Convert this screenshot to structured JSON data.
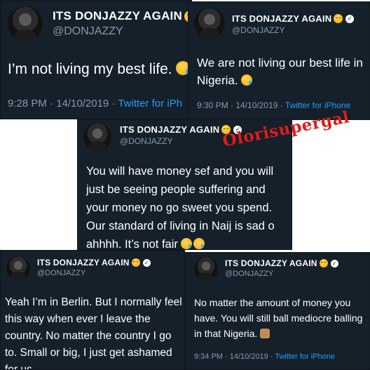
{
  "tweets": [
    {
      "display_name": "ITS DONJAZZY AGAIN",
      "handle": "@DONJAZZY",
      "text": "I’m not living my best life.",
      "time": "9:28 PM · 14/10/2019 ·",
      "source": "Twitter for iPh"
    },
    {
      "display_name": "ITS DONJAZZY AGAIN",
      "handle": "@DONJAZZY",
      "text": "We are not living our best life in Nigeria.",
      "time": "9:30 PM · 14/10/2019 ·",
      "source": "Twitter for iPhone"
    },
    {
      "display_name": "ITS DONJAZZY AGAIN",
      "handle": "@DONJAZZY",
      "text": "You will have money sef and you will just be seeing people suffering and your money no go sweet you spend. Our standard of living in Naij is sad o ahhhh. It’s not fair"
    },
    {
      "display_name": "ITS DONJAZZY AGAIN",
      "handle": "@DONJAZZY",
      "text": "Yeah I’m in Berlin. But I normally feel this way when ever I leave the country. No matter the country I go to. Small or big, I just get ashamed for us."
    },
    {
      "display_name": "ITS DONJAZZY AGAIN",
      "handle": "@DONJAZZY",
      "text": "No matter the amount of money you have. You will still ball mediocre balling in that Nigeria.",
      "time": "9:34 PM · 14/10/2019 ·",
      "source": "Twitter for iPhone"
    }
  ],
  "watermark": "Olorisupergal",
  "icons": {
    "verified": "verified-badge-icon",
    "emoji_smirk": "smirk-emoji-icon",
    "emoji_cry": "crying-face-emoji-icon",
    "emoji_person": "man-facepalming-emoji-icon",
    "chevron": "chevron-down-icon"
  },
  "colors": {
    "card_bg": "#15202b",
    "muted": "#8899a6",
    "link": "#1da1f2",
    "watermark": "#e01b1b"
  }
}
